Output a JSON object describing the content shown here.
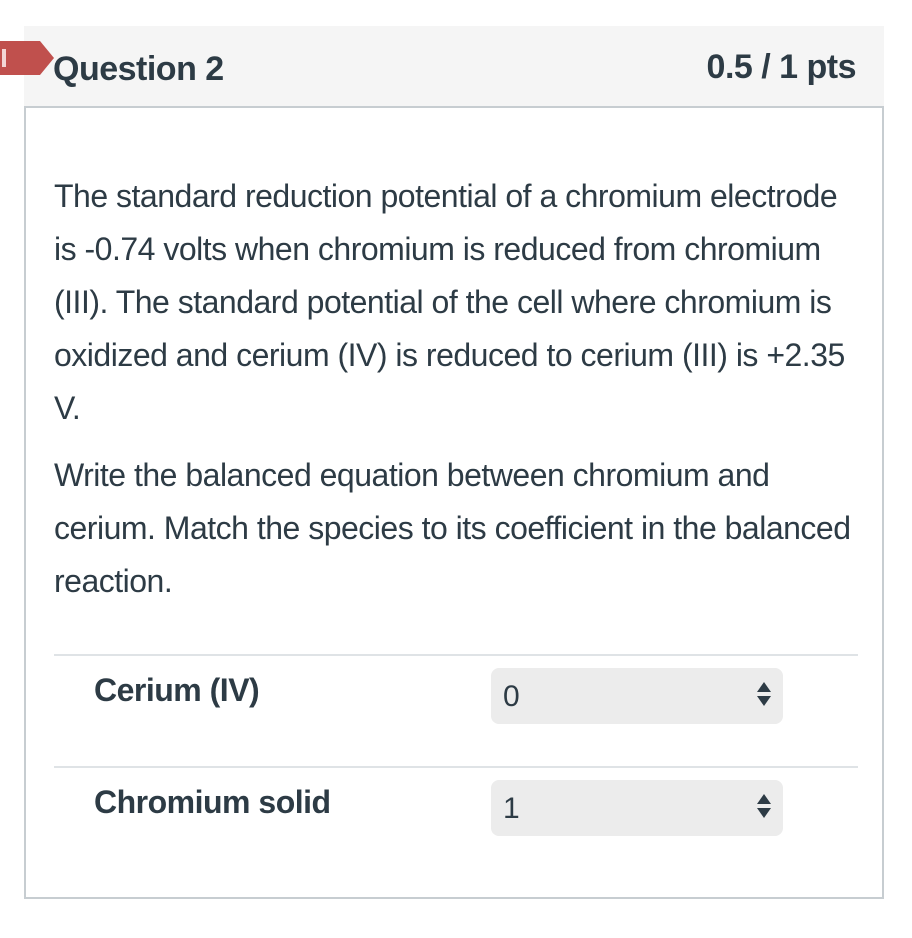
{
  "question": {
    "title": "Question 2",
    "points": "0.5 / 1 pts",
    "flag_icon": "flag-marker-icon",
    "paragraphs": [
      "The standard reduction potential of a chromium electrode is -0.74 volts when chromium is reduced from chromium (III). The standard potential of the cell where chromium is oxidized and cerium (IV) is reduced to cerium (III) is +2.35 V.",
      "Write the balanced equation between chromium and cerium. Match the species to its coefficient in the balanced reaction."
    ],
    "matches": [
      {
        "label": "Cerium (IV)",
        "selected": "0"
      },
      {
        "label": "Chromium solid",
        "selected": "1"
      }
    ]
  },
  "colors": {
    "flag": "#c0504d",
    "header_bg": "#f5f5f5",
    "border": "#c7cdd1",
    "text": "#2d3b45",
    "select_bg": "#ececec"
  }
}
